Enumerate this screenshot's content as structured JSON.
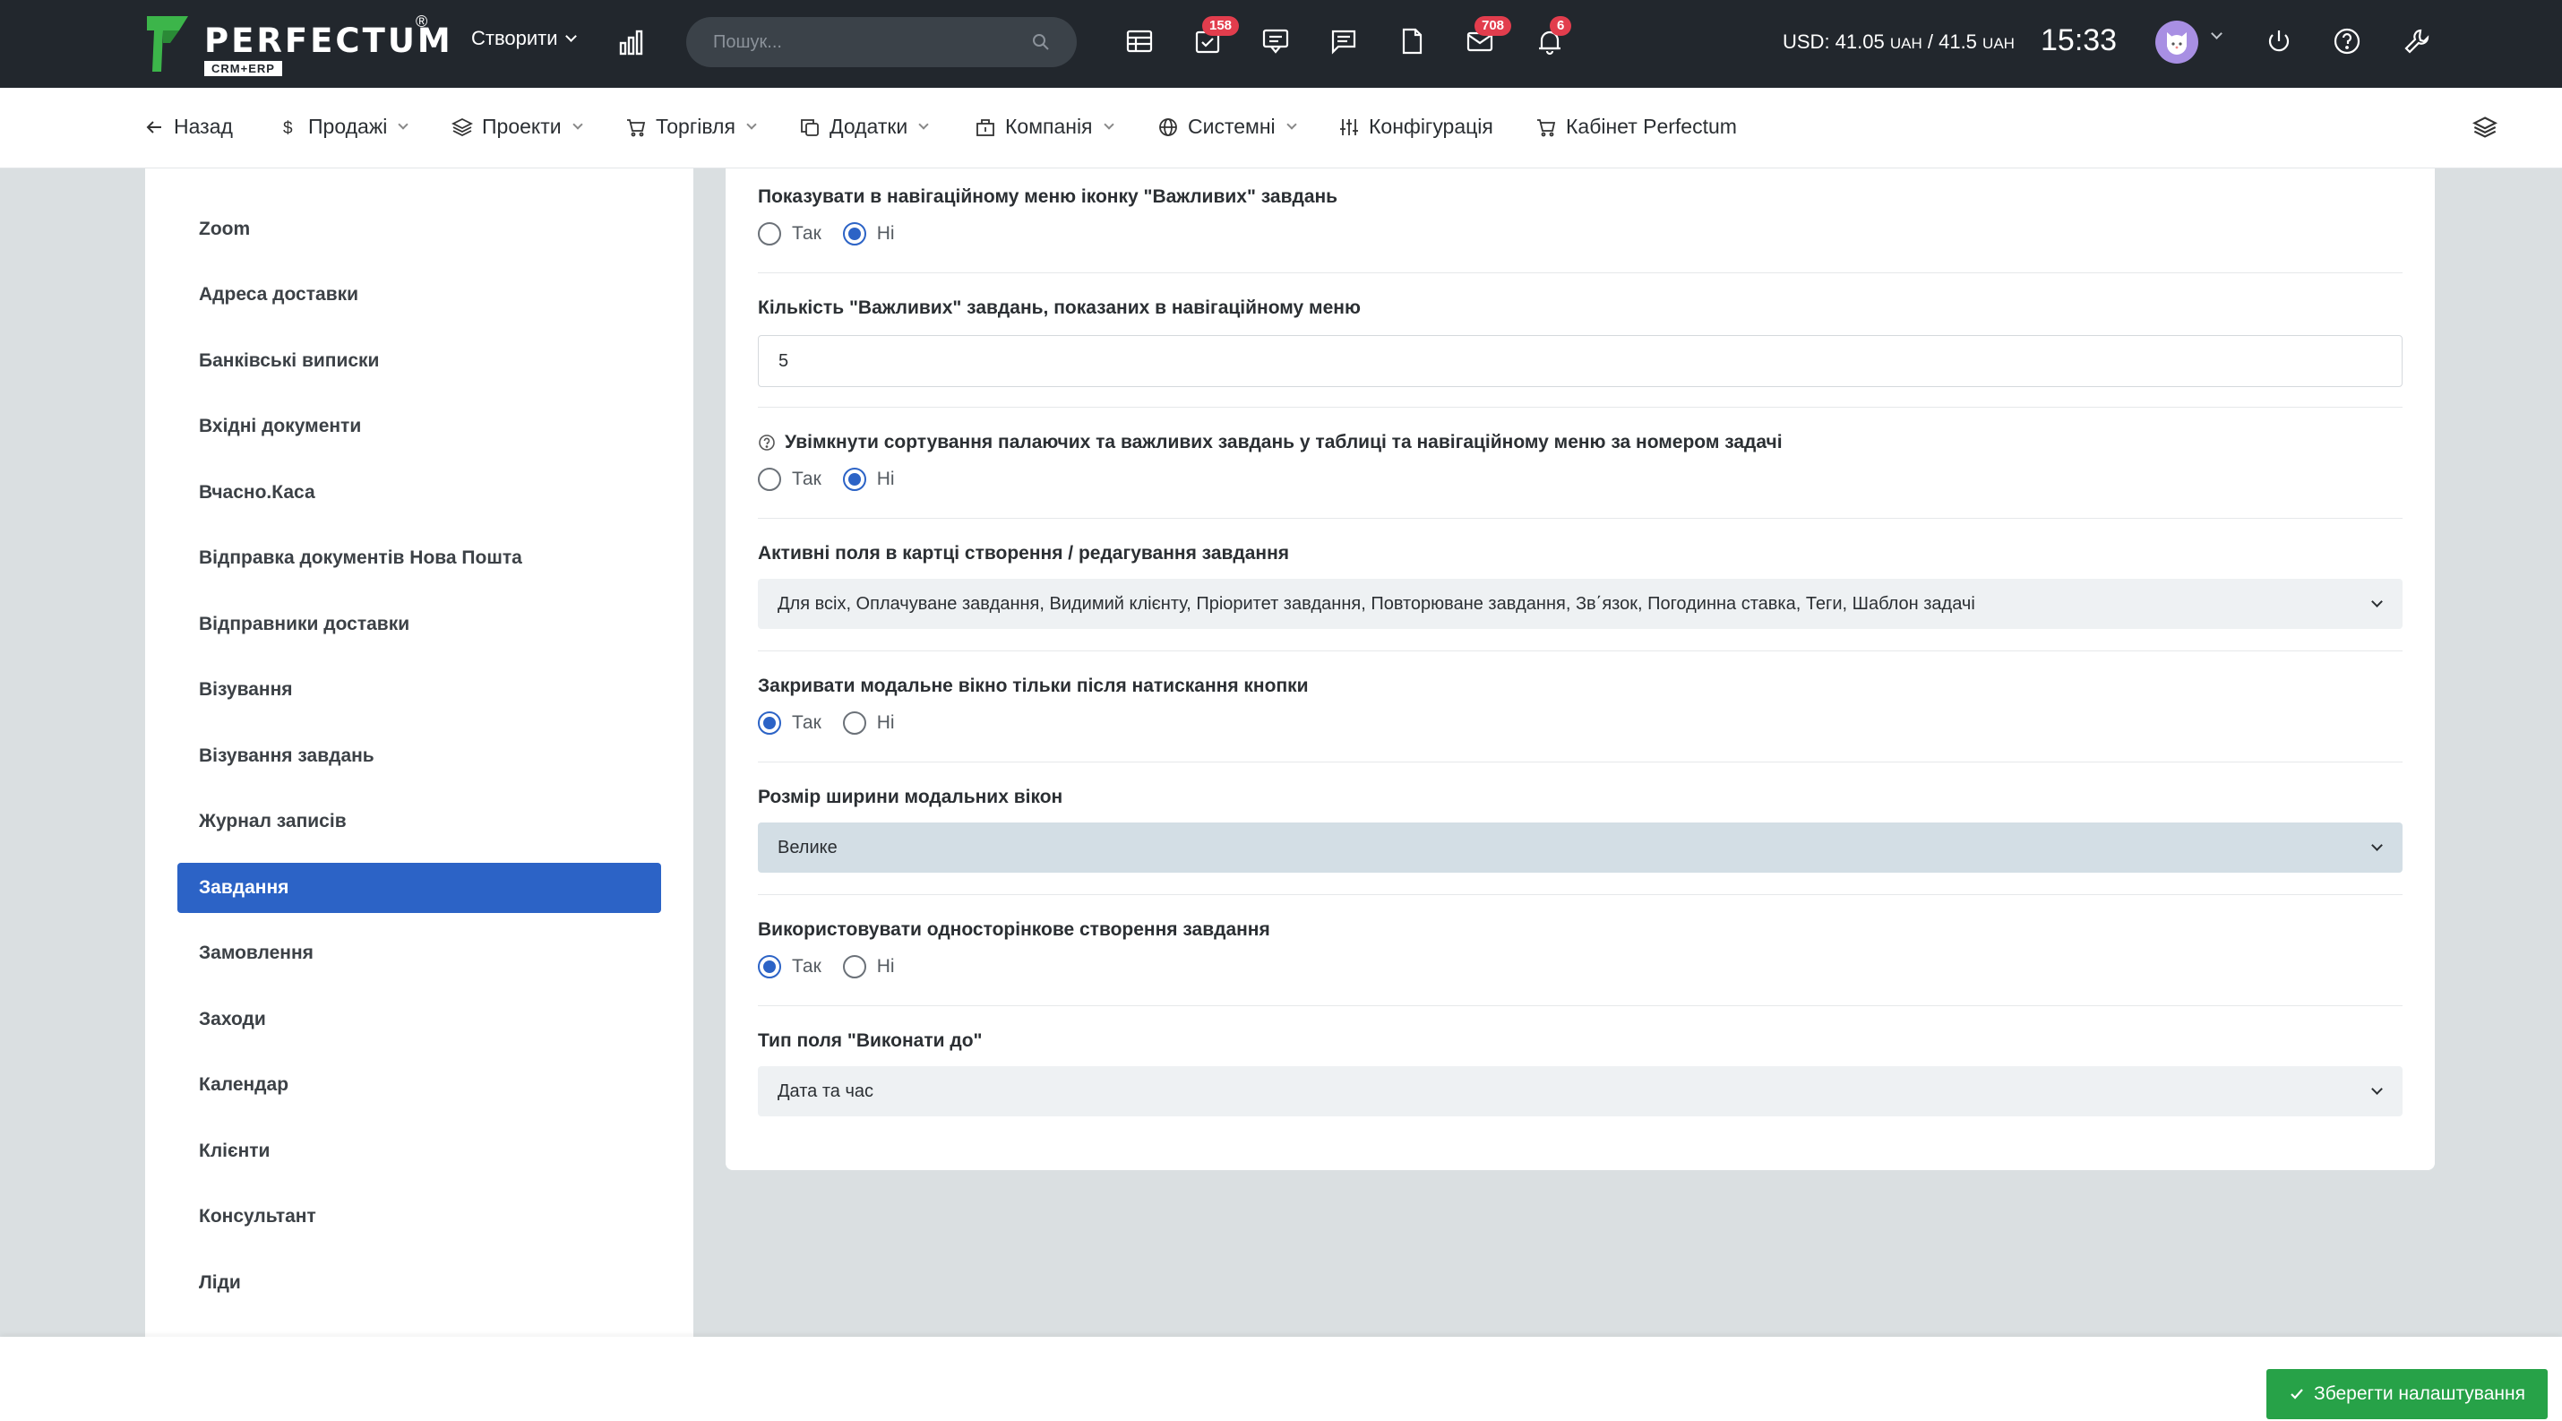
{
  "brand": {
    "name": "PERFECTUM",
    "sub": "CRM+ERP",
    "reg": "®"
  },
  "topbar": {
    "create_label": "Створити",
    "search_placeholder": "Пошук...",
    "badges": {
      "tasks": "158",
      "mail": "708",
      "notifications": "6"
    },
    "currency": {
      "prefix": "USD: 41.05",
      "unit1": "UAH",
      "sep": " / 41.5",
      "unit2": "UAH"
    },
    "time": "15:33"
  },
  "nav": {
    "back": "Назад",
    "sales": "Продажі",
    "projects": "Проекти",
    "trade": "Торгівля",
    "addons": "Додатки",
    "company": "Компанія",
    "system": "Системні",
    "config": "Конфігурація",
    "cabinet": "Кабінет Perfectum"
  },
  "sidebar": {
    "items": [
      "Zoom",
      "Адреса доставки",
      "Банківські виписки",
      "Вхідні документи",
      "Вчасно.Каса",
      "Відправка документів Нова Пошта",
      "Відправники доставки",
      "Візування",
      "Візування завдань",
      "Журнал записів",
      "Завдання",
      "Замовлення",
      "Заходи",
      "Календар",
      "Клієнти",
      "Консультант",
      "Ліди"
    ],
    "active": "Завдання"
  },
  "settings": {
    "f1": {
      "label": "Показувати в навігаційному меню іконку \"Важливих\" завдань",
      "yes": "Так",
      "no": "Ні",
      "value": "no"
    },
    "f2": {
      "label": "Кількість \"Важливих\" завдань, показаних в навігаційному меню",
      "value": "5"
    },
    "f3": {
      "label": "Увімкнути сортування палаючих та важливих завдань у таблиці та навігаційному меню за номером задачі",
      "yes": "Так",
      "no": "Ні",
      "value": "no"
    },
    "f4": {
      "label": "Активні поля в картці створення / редагування завдання",
      "value": "Для всіх, Оплачуване завдання, Видимий клієнту, Пріоритет завдання, Повторюване завдання, Зв΄язок, Погодинна ставка, Теги, Шаблон задачі"
    },
    "f5": {
      "label": "Закривати модальне вікно тільки після натискання кнопки",
      "yes": "Так",
      "no": "Ні",
      "value": "yes"
    },
    "f6": {
      "label": "Розмір ширини модальних вікон",
      "value": "Велике"
    },
    "f7": {
      "label": "Використовувати односторінкове створення завдання",
      "yes": "Так",
      "no": "Ні",
      "value": "yes"
    },
    "f8": {
      "label": "Тип поля \"Виконати до\"",
      "value": "Дата та час"
    }
  },
  "footer": {
    "save_label": "Зберегти налаштування"
  },
  "colors": {
    "accent": "#2c63c6",
    "save": "#27a248",
    "badge": "#e23d4d",
    "topbar": "#22272d",
    "logo_green": "#3cb54a"
  }
}
